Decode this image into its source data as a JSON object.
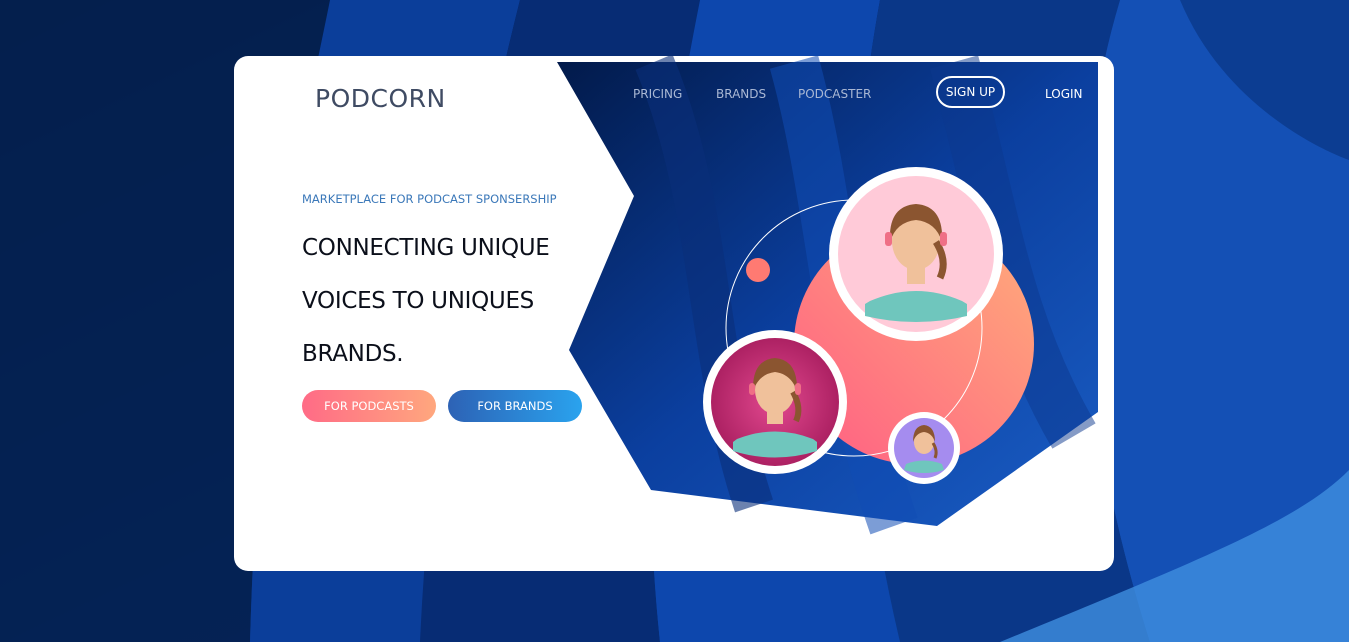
{
  "brand": {
    "logo": "PODCORN"
  },
  "nav": {
    "items": [
      "PRICING",
      "BRANDS",
      "PODCASTER"
    ],
    "signup": "SIGN UP",
    "login": "LOGIN"
  },
  "hero": {
    "eyebrow": "MARKETPLACE FOR PODCAST SPONSERSHIP",
    "headline": [
      "CONNECTING UNIQUE",
      "VOICES TO UNIQUES",
      "BRANDS."
    ],
    "buttons": {
      "podcasts": "FOR PODCASTS",
      "brands": "FOR BRANDS"
    }
  },
  "colors": {
    "page_bg": "#062a6e",
    "card_bg": "#ffffff",
    "logo": "#3f4b63",
    "eyebrow": "#3b78b9",
    "pink_grad_start": "#ff6b86",
    "pink_grad_end": "#ffa77e",
    "blue_grad_start": "#2d62b5",
    "blue_grad_end": "#2aa3ee"
  },
  "illustration": {
    "avatars": [
      "avatar-pink-bg",
      "avatar-magenta-bg",
      "avatar-purple-bg"
    ]
  }
}
